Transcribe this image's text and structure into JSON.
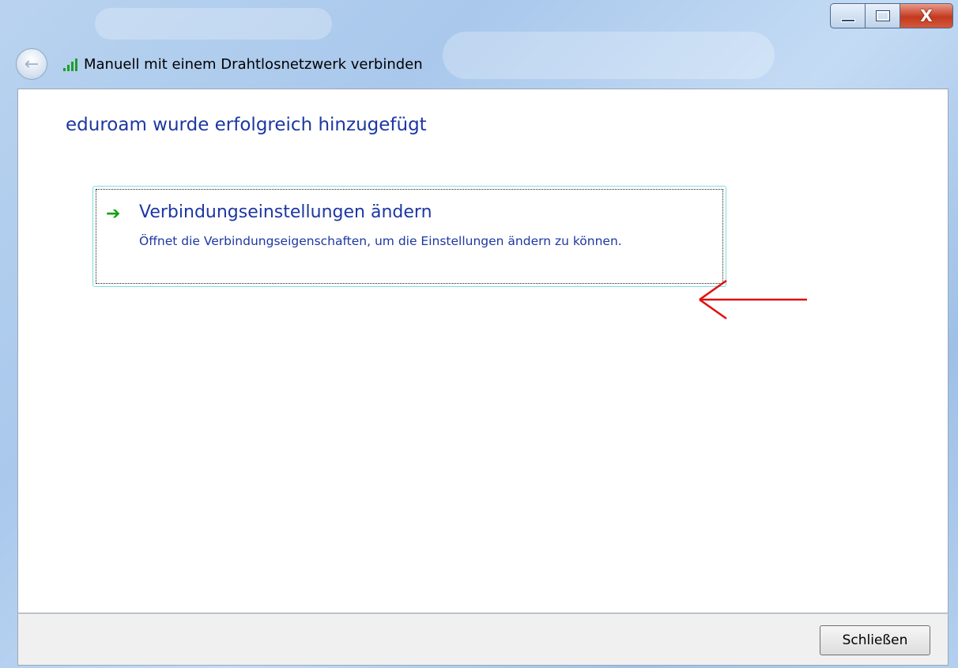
{
  "window": {
    "title": "Manuell mit einem Drahtlosnetzwerk verbinden",
    "controls": {
      "minimize_icon": "minimize-icon",
      "maximize_icon": "maximize-icon",
      "close_glyph": "X"
    }
  },
  "nav": {
    "back_icon": "back-arrow-icon",
    "network_icon": "wireless-signal-icon"
  },
  "main": {
    "heading": "eduroam wurde erfolgreich hinzugefügt",
    "command_link": {
      "icon": "green-arrow-icon",
      "title": "Verbindungseinstellungen ändern",
      "description": "Öffnet die Verbindungseigenschaften, um die Einstellungen ändern zu können."
    }
  },
  "footer": {
    "close_button_label": "Schließen"
  },
  "colors": {
    "link_blue": "#1d37a3",
    "annotation_red": "#e01010",
    "accent_green": "#12a314"
  }
}
